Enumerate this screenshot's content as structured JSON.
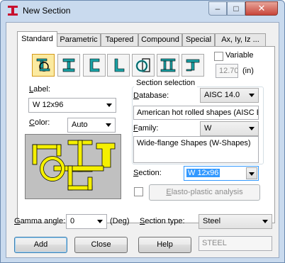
{
  "window": {
    "title": "New Section",
    "buttons": {
      "minimize": "–",
      "maximize": "□",
      "close": "✕"
    }
  },
  "tabs": [
    {
      "label": "Standard",
      "active": true
    },
    {
      "label": "Parametric"
    },
    {
      "label": "Tapered"
    },
    {
      "label": "Compound"
    },
    {
      "label": "Special"
    },
    {
      "label": "Ax, Iy, Iz ..."
    }
  ],
  "shape_buttons": [
    {
      "icon": "combined-section-icon",
      "active": true
    },
    {
      "icon": "i-section-icon"
    },
    {
      "icon": "channel-section-icon"
    },
    {
      "icon": "angle-section-icon"
    },
    {
      "icon": "tube-section-icon"
    },
    {
      "icon": "double-i-section-icon"
    },
    {
      "icon": "tee-section-icon"
    }
  ],
  "variable": {
    "label": "Variable",
    "checked": false,
    "value": "12.70",
    "unit": "(in)"
  },
  "label_field": {
    "label_u": "L",
    "label_rest": "abel:",
    "value": "W 12x96"
  },
  "color_field": {
    "label_u": "C",
    "label_rest": "olor:",
    "value": "Auto"
  },
  "section_selection": {
    "title": "Section selection",
    "database_label_u": "D",
    "database_label_rest": "atabase:",
    "database": "AISC 14.0",
    "database_description": "American hot rolled shapes (AISC E",
    "family_label_u": "F",
    "family_label_rest": "amily:",
    "family": "W",
    "family_description": "Wide-flange Shapes (W-Shapes)",
    "section_label_u": "S",
    "section_label_rest": "ection:",
    "section": "W 12x96"
  },
  "elasto": {
    "label_u": "E",
    "label_rest": "lasto-plastic analysis",
    "checked": false
  },
  "gamma": {
    "label_u": "G",
    "label_rest": "amma angle:",
    "value": "0",
    "unit": "(Deg)"
  },
  "section_type": {
    "label_u": "S",
    "label_rest": "ection type:",
    "value": "Steel",
    "material": "STEEL"
  },
  "actions": {
    "add": "Add",
    "close": "Close",
    "help": "Help"
  },
  "colors": {
    "section_fill": "#f5f000",
    "preview_bg": "#c0c0c0",
    "icon_teal": "#1aa2a6",
    "active_bg": "#fbeaa0"
  }
}
